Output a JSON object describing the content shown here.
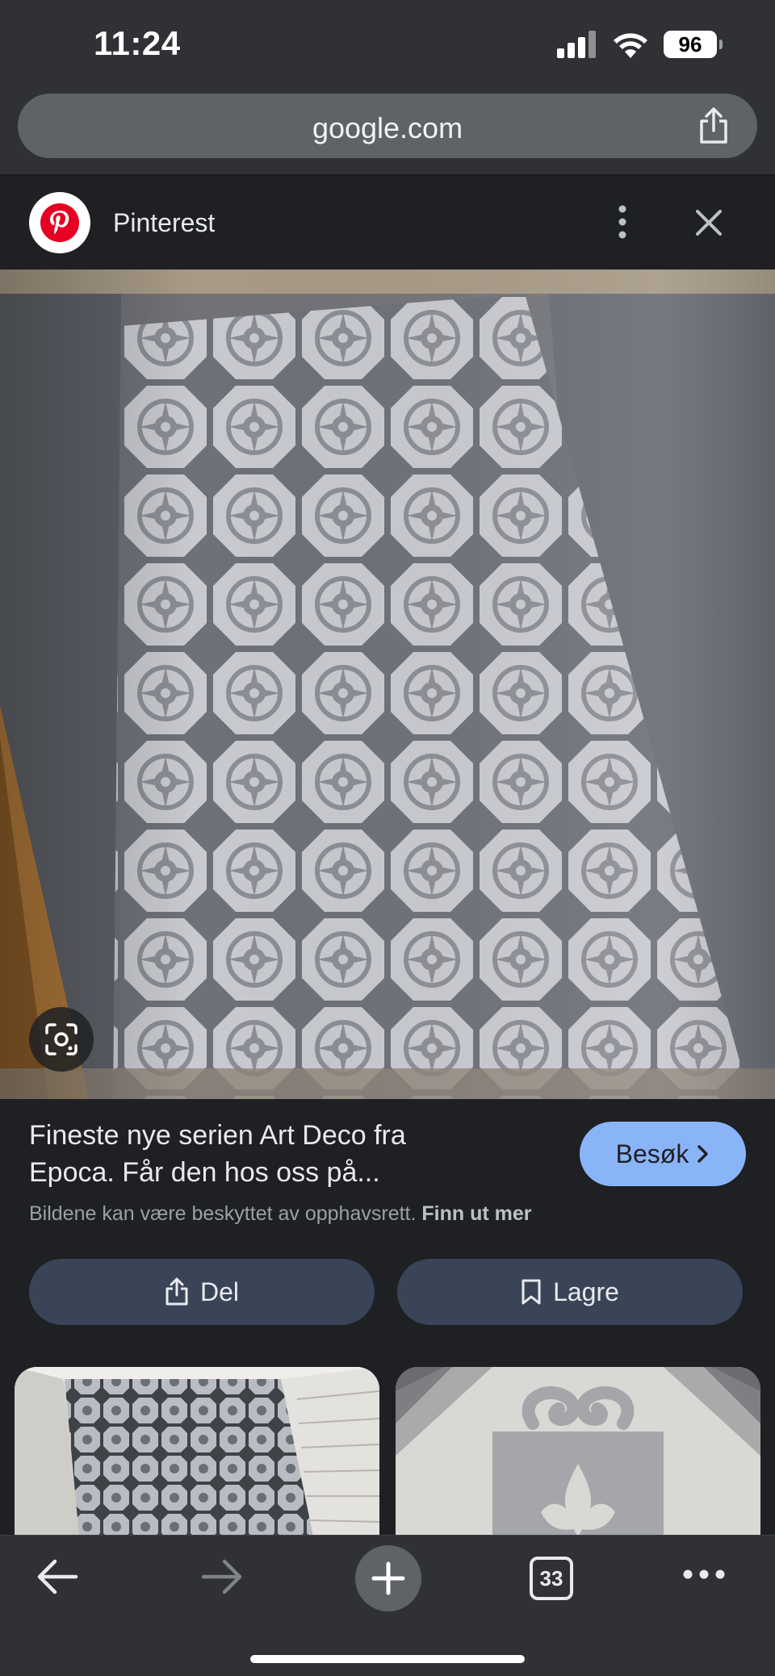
{
  "status_bar": {
    "time": "11:24",
    "battery": "96"
  },
  "browser": {
    "url": "google.com"
  },
  "source": {
    "name": "Pinterest"
  },
  "result": {
    "title_line1": "Fineste nye serien Art Deco fra",
    "title_line2": "Epoca. Får den hos oss på...",
    "visit_label": "Besøk",
    "copyright_text": "Bildene kan være beskyttet av opphavsrett.",
    "learn_more": "Finn ut mer"
  },
  "actions": {
    "share_label": "Del",
    "save_label": "Lagre"
  },
  "toolbar": {
    "tabs_count": "33"
  },
  "colors": {
    "accent": "#8ab4f8",
    "button_bg": "#394457",
    "pinterest_red": "#e60023"
  },
  "icons": [
    "signal-icon",
    "wifi-icon",
    "battery-icon",
    "share-icon",
    "pinterest-logo",
    "more-vert-icon",
    "close-icon",
    "lens-icon",
    "chevron-right-icon",
    "upload-icon",
    "bookmark-icon",
    "back-icon",
    "forward-icon",
    "plus-icon",
    "tabs-icon",
    "more-horiz-icon"
  ]
}
